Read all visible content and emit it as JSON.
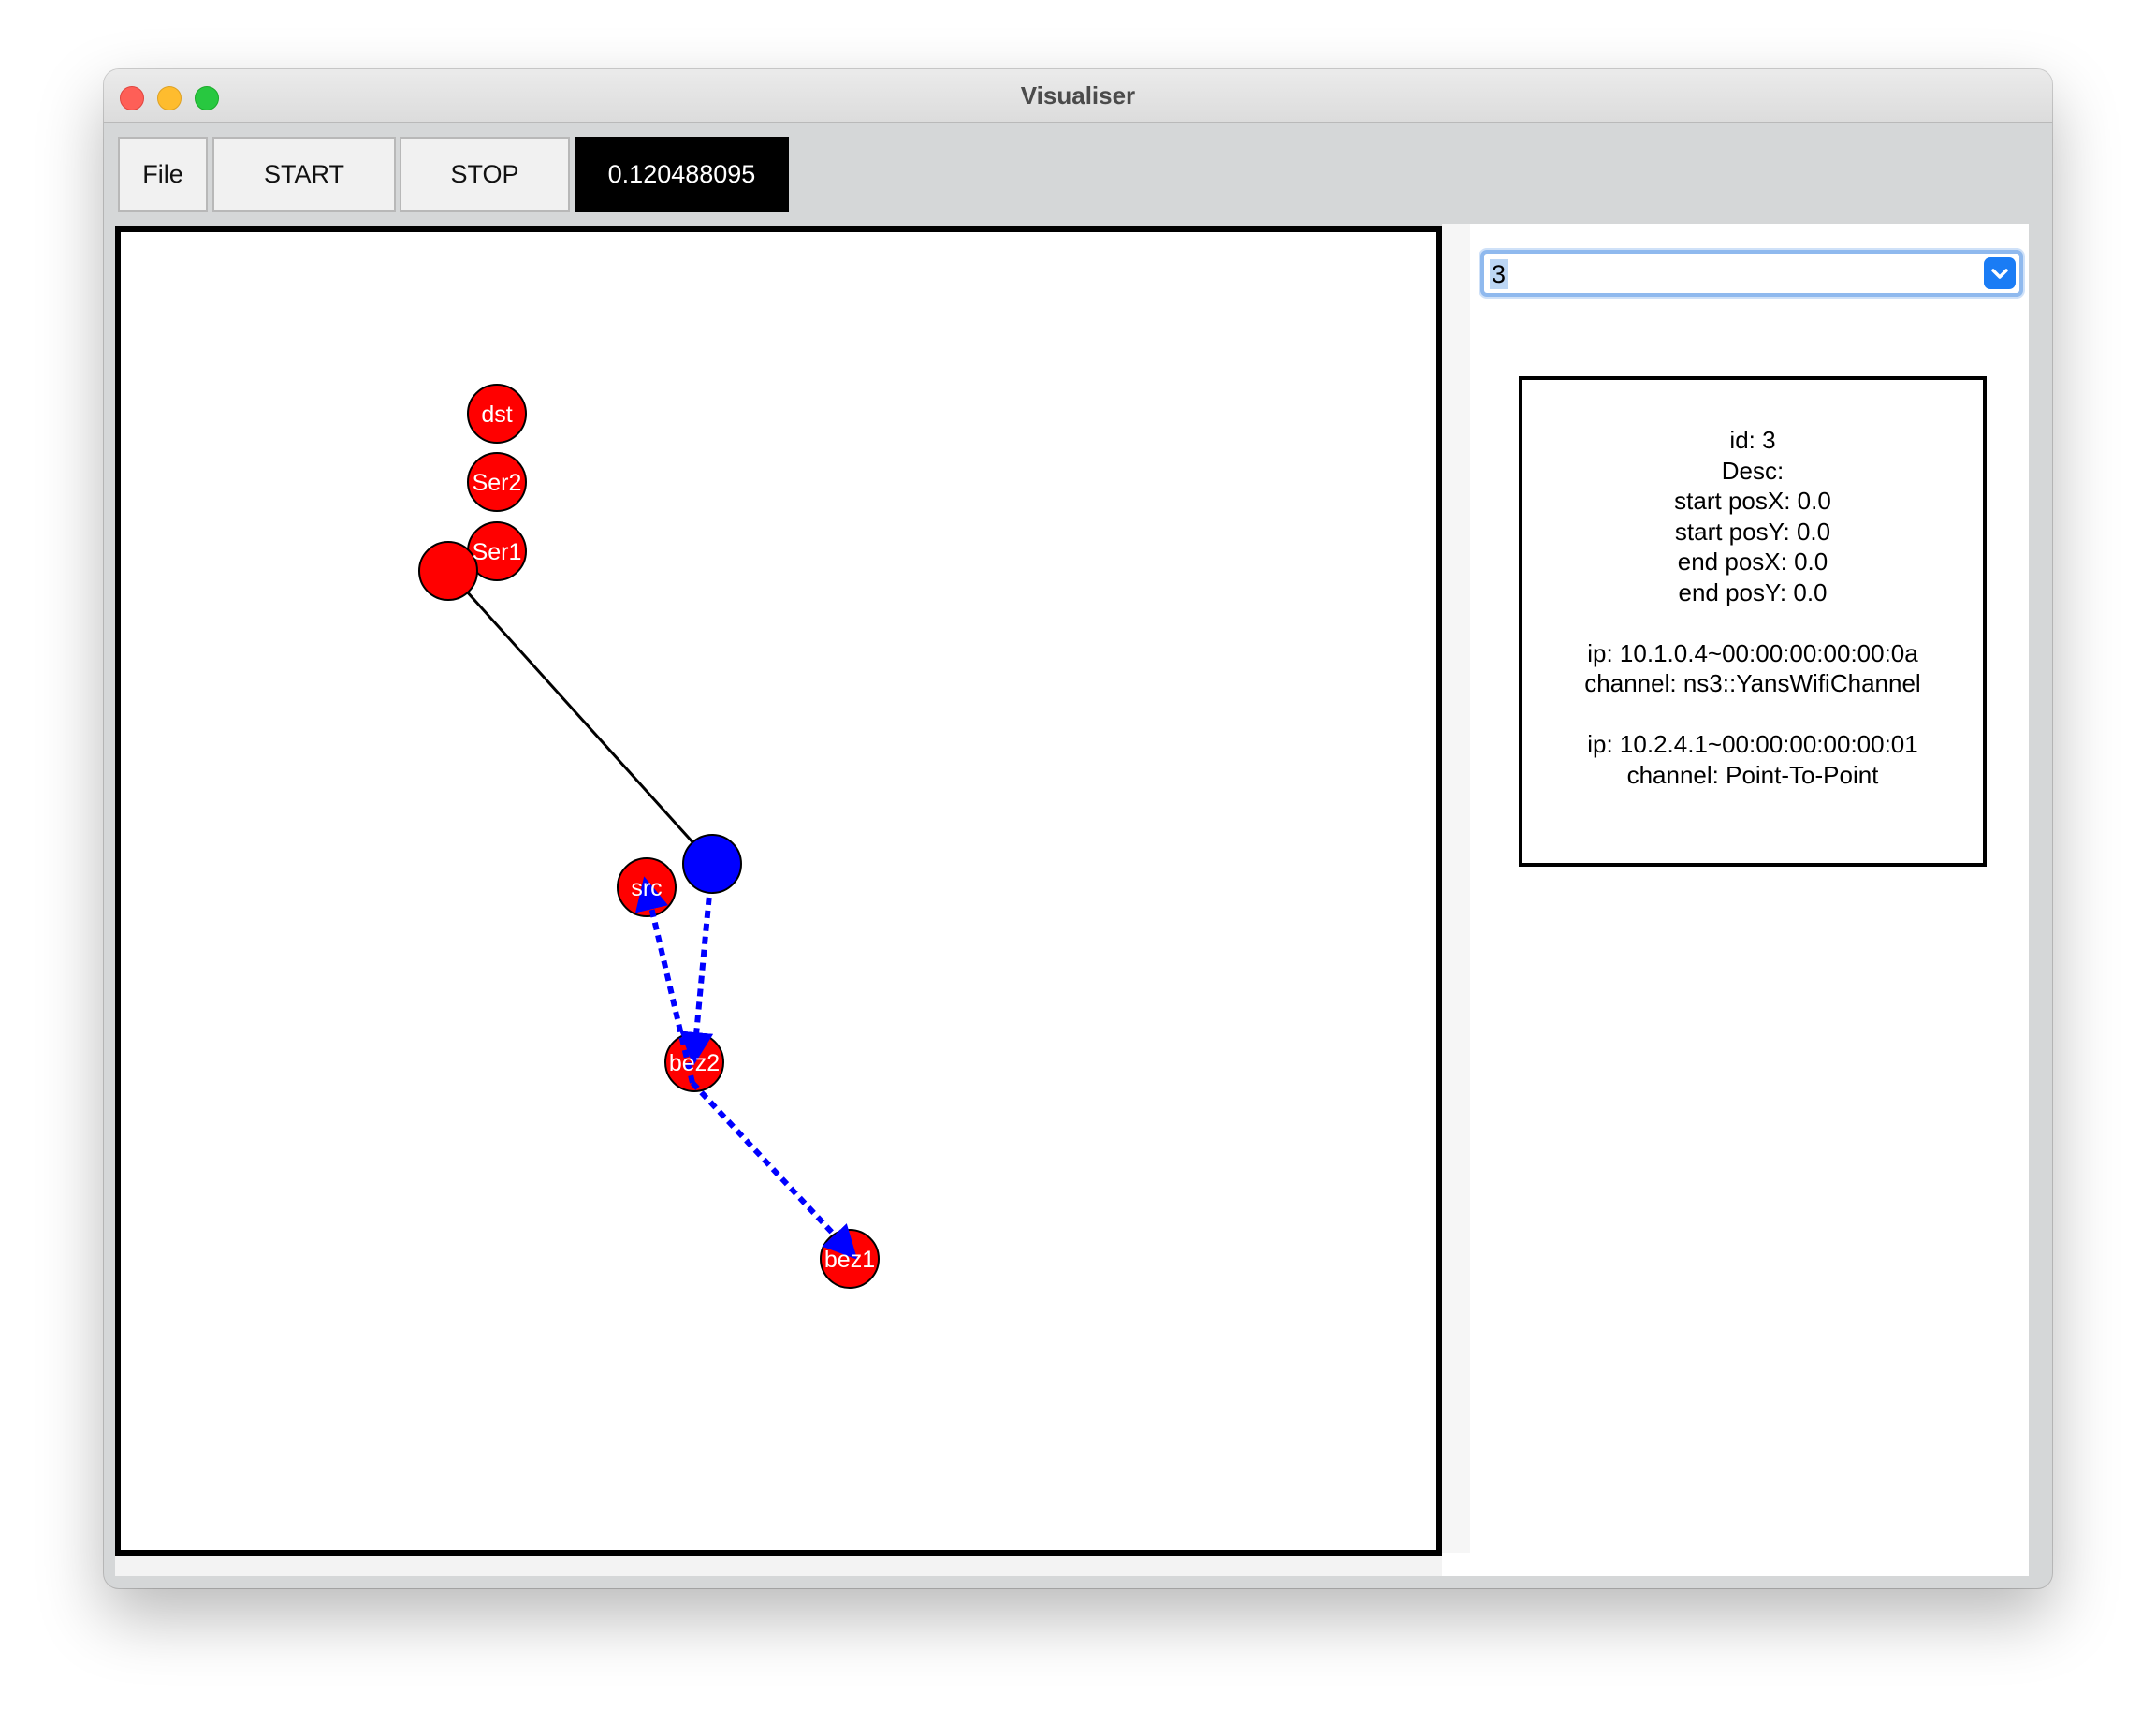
{
  "window": {
    "title": "Visualiser"
  },
  "toolbar": {
    "file_label": "File",
    "start_label": "START",
    "stop_label": "STOP",
    "time_value": "0.120488095"
  },
  "node_select": {
    "selected_value": "3"
  },
  "node_info": {
    "id_line": "id: 3",
    "desc_line": "Desc:",
    "start_posx_line": "start posX: 0.0",
    "start_posy_line": "start posY: 0.0",
    "end_posx_line": "end posX: 0.0",
    "end_posy_line": "end posY: 0.0",
    "interfaces": [
      {
        "ip_line": "ip: 10.1.0.4~00:00:00:00:00:0a",
        "channel_line": "channel: ns3::YansWifiChannel"
      },
      {
        "ip_line": "ip: 10.2.4.1~00:00:00:00:00:01",
        "channel_line": "channel: Point-To-Point"
      }
    ]
  },
  "network": {
    "colors": {
      "node_fill": "#ff0000",
      "selected_node_fill": "#0000ff",
      "link": "#000000",
      "packet_flow": "#0000ff"
    },
    "nodes": [
      {
        "id": "dst",
        "label": "dst"
      },
      {
        "id": "ser2",
        "label": "Ser2"
      },
      {
        "id": "ser1",
        "label": "Ser1"
      },
      {
        "id": "router",
        "label": ""
      },
      {
        "id": "selected",
        "label": ""
      },
      {
        "id": "src",
        "label": "src"
      },
      {
        "id": "bez2",
        "label": "bez2"
      },
      {
        "id": "bez1",
        "label": "bez1"
      }
    ],
    "links": [
      {
        "from": "router",
        "to": "selected",
        "style": "solid"
      }
    ],
    "packet_flows": [
      {
        "from": "selected",
        "to": "bez2"
      },
      {
        "from": "bez2",
        "to": "src"
      },
      {
        "from": "bez2",
        "to": "bez1"
      }
    ]
  }
}
